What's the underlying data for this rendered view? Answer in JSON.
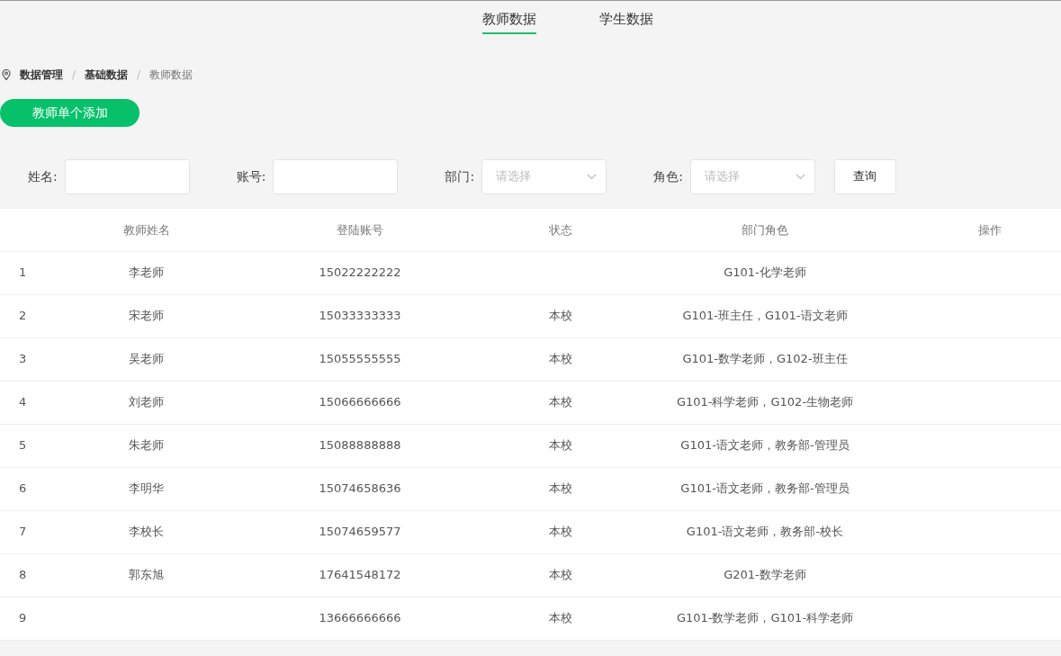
{
  "tabs": [
    {
      "label": "教师数据",
      "selected": true
    },
    {
      "label": "学生数据",
      "selected": false
    }
  ],
  "breadcrumb": [
    {
      "label": "数据管理",
      "current": false
    },
    {
      "label": "基础数据",
      "current": false
    },
    {
      "label": "教师数据",
      "current": true
    }
  ],
  "breadcrumb_separator": "/",
  "add_button": "教师单个添加",
  "filters": [
    {
      "kind": "input",
      "label": "姓名:"
    },
    {
      "kind": "input",
      "label": "账号:"
    },
    {
      "kind": "select",
      "label": "部门:",
      "placeholder": "请选择"
    },
    {
      "kind": "select",
      "label": "角色:",
      "placeholder": "请选择"
    }
  ],
  "query_button": "查询",
  "table": {
    "columns": [
      "教师姓名",
      "登陆账号",
      "状态",
      "部门角色",
      "操作"
    ],
    "rows": [
      {
        "index": "1",
        "name": "李老师",
        "account": "15022222222",
        "roles": "G101-化学老师"
      },
      {
        "index": "2",
        "name": "宋老师",
        "account": "15033333333",
        "status": "本校",
        "roles": "G101-班主任，G101-语文老师"
      },
      {
        "index": "3",
        "name": "吴老师",
        "account": "15055555555",
        "status": "本校",
        "roles": "G101-数学老师，G102-班主任"
      },
      {
        "index": "4",
        "name": "刘老师",
        "account": "15066666666",
        "status": "本校",
        "roles": "G101-科学老师，G102-生物老师"
      },
      {
        "index": "5",
        "name": "朱老师",
        "account": "15088888888",
        "status": "本校",
        "roles": "G101-语文老师，教务部-管理员"
      },
      {
        "index": "6",
        "name": "李明华",
        "account": "15074658636",
        "status": "本校",
        "roles": "G101-语文老师，教务部-管理员"
      },
      {
        "index": "7",
        "name": "李校长",
        "account": "15074659577",
        "status": "本校",
        "roles": "G101-语文老师，教务部-校长"
      },
      {
        "index": "8",
        "name": "郭东旭",
        "account": "17641548172",
        "status": "本校",
        "roles": "G201-数学老师"
      },
      {
        "index": "9",
        "account": "13666666666",
        "status": "本校",
        "roles": "G101-数学老师，G101-科学老师"
      }
    ]
  }
}
